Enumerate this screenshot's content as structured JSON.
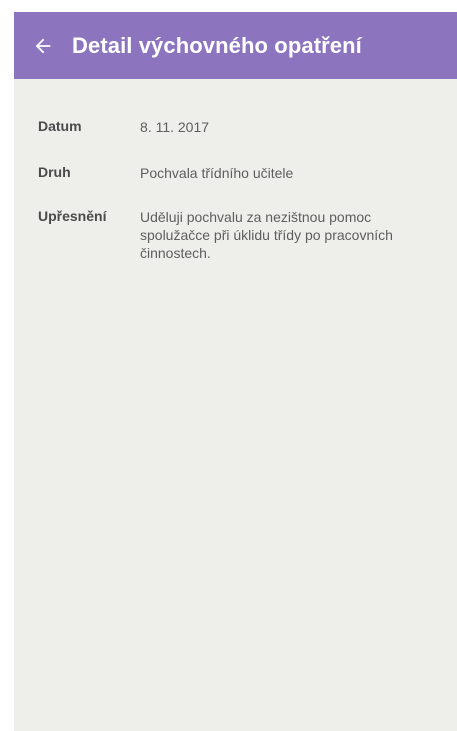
{
  "header": {
    "back_icon": "arrow-left-icon",
    "title": "Detail výchovného opatření"
  },
  "details": {
    "date": {
      "label": "Datum",
      "value": "8. 11. 2017"
    },
    "type": {
      "label": "Druh",
      "value": "Pochvala třídního učitele"
    },
    "note": {
      "label": "Upřesnění",
      "value": "Uděluji pochvalu za nezištnou pomoc spolužačce při úklidu třídy po pracovních činnostech."
    }
  },
  "colors": {
    "app_bar": "#8c74be",
    "background": "#eeeeea",
    "label_text": "#4a4a4a",
    "value_text": "#5e5e5e"
  }
}
